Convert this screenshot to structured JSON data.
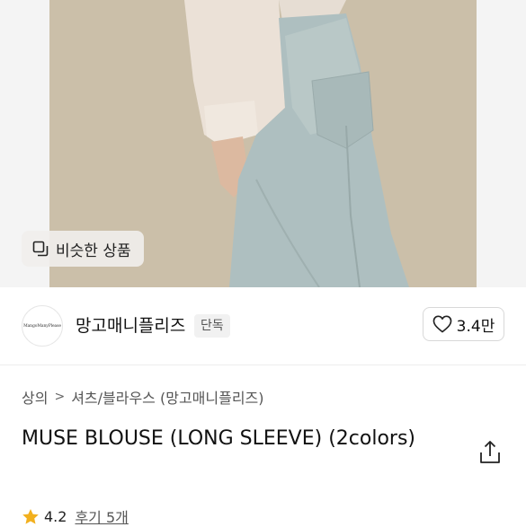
{
  "hero": {
    "similar_button_label": "비슷한 상품"
  },
  "seller": {
    "avatar_text": "MangoManyPlease",
    "name": "망고매니플리즈",
    "badge": "단독",
    "like_count": "3.4만"
  },
  "product": {
    "breadcrumb": [
      "상의",
      "셔츠/블라우스 (망고매니플리즈)"
    ],
    "breadcrumb_separator": ">",
    "title": "MUSE BLOUSE (LONG SLEEVE) (2colors)"
  },
  "rating": {
    "score": "4.2",
    "reviews": "후기 5개"
  },
  "colors": {
    "star": "#f2b01e",
    "text": "#111111",
    "muted": "#555555"
  },
  "icons": {
    "similar": "similar-products-icon",
    "like": "heart-icon",
    "share": "share-icon",
    "star": "star-icon"
  }
}
